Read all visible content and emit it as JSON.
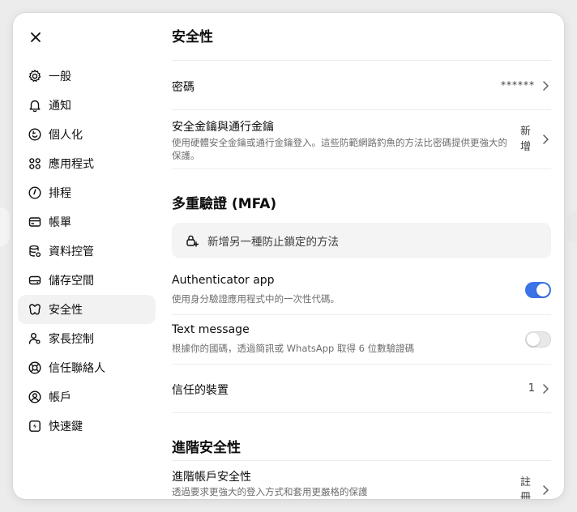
{
  "sidebar": {
    "items": [
      {
        "label": "一般",
        "icon": "gear-icon"
      },
      {
        "label": "通知",
        "icon": "bell-icon"
      },
      {
        "label": "個人化",
        "icon": "personalize-icon"
      },
      {
        "label": "應用程式",
        "icon": "apps-grid-icon"
      },
      {
        "label": "排程",
        "icon": "clock-icon"
      },
      {
        "label": "帳單",
        "icon": "card-icon"
      },
      {
        "label": "資料控管",
        "icon": "database-icon"
      },
      {
        "label": "儲存空間",
        "icon": "storage-icon"
      },
      {
        "label": "安全性",
        "icon": "security-icon"
      },
      {
        "label": "家長控制",
        "icon": "family-icon"
      },
      {
        "label": "信任聯絡人",
        "icon": "lifebuoy-icon"
      },
      {
        "label": "帳戶",
        "icon": "account-icon"
      },
      {
        "label": "快速鍵",
        "icon": "shortcut-icon"
      }
    ],
    "active_index": 8
  },
  "main": {
    "title": "安全性",
    "password": {
      "label": "密碼",
      "value": "******"
    },
    "passkeys": {
      "label": "安全金鑰與通行金鑰",
      "desc": "使用硬體安全金鑰或通行金鑰登入。這些防範網路釣魚的方法比密碼提供更強大的保護。",
      "action": "新增"
    },
    "mfa": {
      "title": "多重驗證 (MFA)",
      "add_method": "新增另一種防止鎖定的方法",
      "authenticator": {
        "label": "Authenticator app",
        "desc": "使用身分驗證應用程式中的一次性代碼。",
        "enabled": true
      },
      "text_message": {
        "label": "Text message",
        "desc": "根據你的國碼，透過簡訊或 WhatsApp 取得 6 位數驗證碼",
        "enabled": false
      },
      "trusted_devices": {
        "label": "信任的裝置",
        "count": "1"
      }
    },
    "advanced": {
      "title": "進階安全性",
      "account": {
        "label": "進階帳戶安全性",
        "desc": "透過要求更強大的登入方式和套用更嚴格的保護",
        "action": "註冊"
      }
    }
  },
  "colors": {
    "accent": "#3b73e8",
    "active_bg": "#f2f2f2",
    "muted_text": "#6e6e6e"
  }
}
